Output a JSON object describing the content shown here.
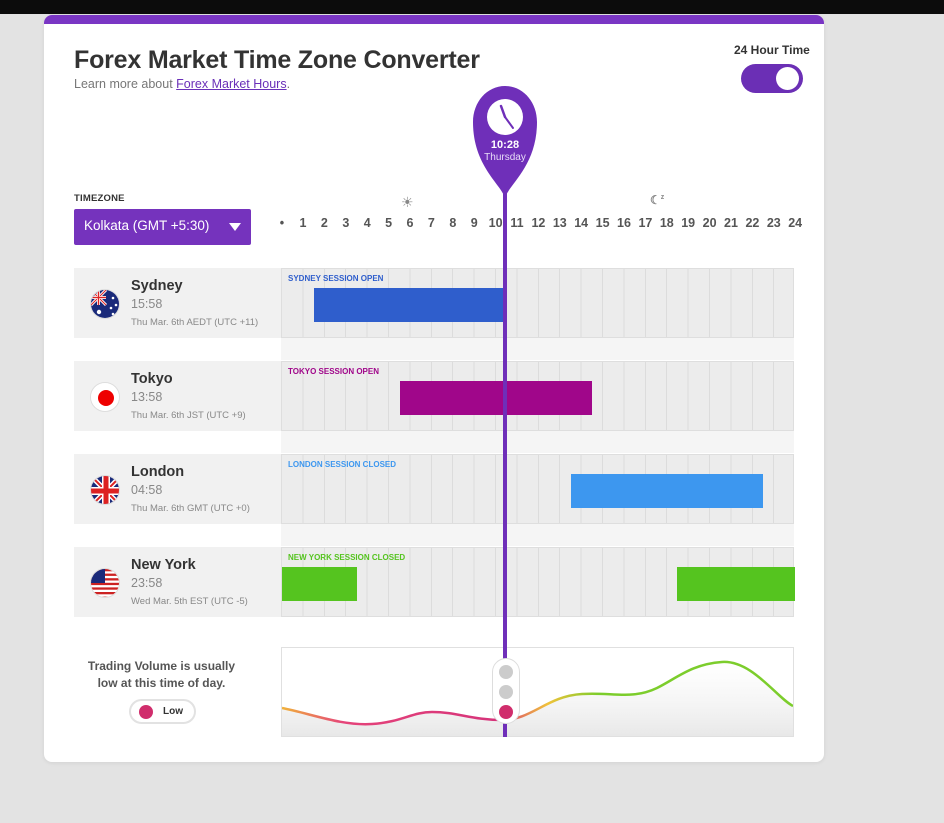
{
  "app": {
    "title": "Forex Market Time Zone Converter",
    "subtitle_prefix": "Learn more about ",
    "subtitle_link": "Forex Market Hours",
    "subtitle_suffix": "."
  },
  "toggle": {
    "label": "24 Hour Time",
    "on": true
  },
  "timezone": {
    "label": "TIMEZONE",
    "value": "Kolkata (GMT +5:30)"
  },
  "now": {
    "time": "10:28",
    "day": "Thursday"
  },
  "hours": [
    "1",
    "2",
    "3",
    "4",
    "5",
    "6",
    "7",
    "8",
    "9",
    "10",
    "11",
    "12",
    "13",
    "14",
    "15",
    "16",
    "17",
    "18",
    "19",
    "20",
    "21",
    "22",
    "23",
    "24"
  ],
  "markets": [
    {
      "city": "Sydney",
      "time": "15:58",
      "date": "Thu Mar. 6th AEDT (UTC +11)",
      "session": "SYDNEY SESSION OPEN",
      "color": "#2f5ecc",
      "label_color": "#2f5ecc",
      "flag": "australia-flag-icon",
      "open_hour": 1.5,
      "close_hour": 10.5
    },
    {
      "city": "Tokyo",
      "time": "13:58",
      "date": "Thu Mar. 6th JST (UTC +9)",
      "session": "TOKYO SESSION OPEN",
      "color": "#a0068a",
      "label_color": "#a0068a",
      "flag": "japan-flag-icon",
      "open_hour": 5.5,
      "close_hour": 14.5
    },
    {
      "city": "London",
      "time": "04:58",
      "date": "Thu Mar. 6th GMT (UTC +0)",
      "session": "LONDON SESSION CLOSED",
      "color": "#3d97ef",
      "label_color": "#3d97ef",
      "flag": "uk-flag-icon",
      "open_hour": 13.5,
      "close_hour": 22.5
    },
    {
      "city": "New York",
      "time": "23:58",
      "date": "Wed Mar. 5th EST (UTC -5)",
      "session": "NEW YORK SESSION CLOSED",
      "color": "#55c41f",
      "label_color": "#55c41f",
      "flag": "usa-flag-icon",
      "open_hour": 0,
      "close_hour": 3.5,
      "open_hour_2": 18.5,
      "close_hour_2": 24
    }
  ],
  "volume": {
    "text": "Trading Volume is usually low at this time of day.",
    "level": "Low",
    "level_color": "#d02d6c"
  },
  "colors": {
    "accent": "#7533bd"
  }
}
